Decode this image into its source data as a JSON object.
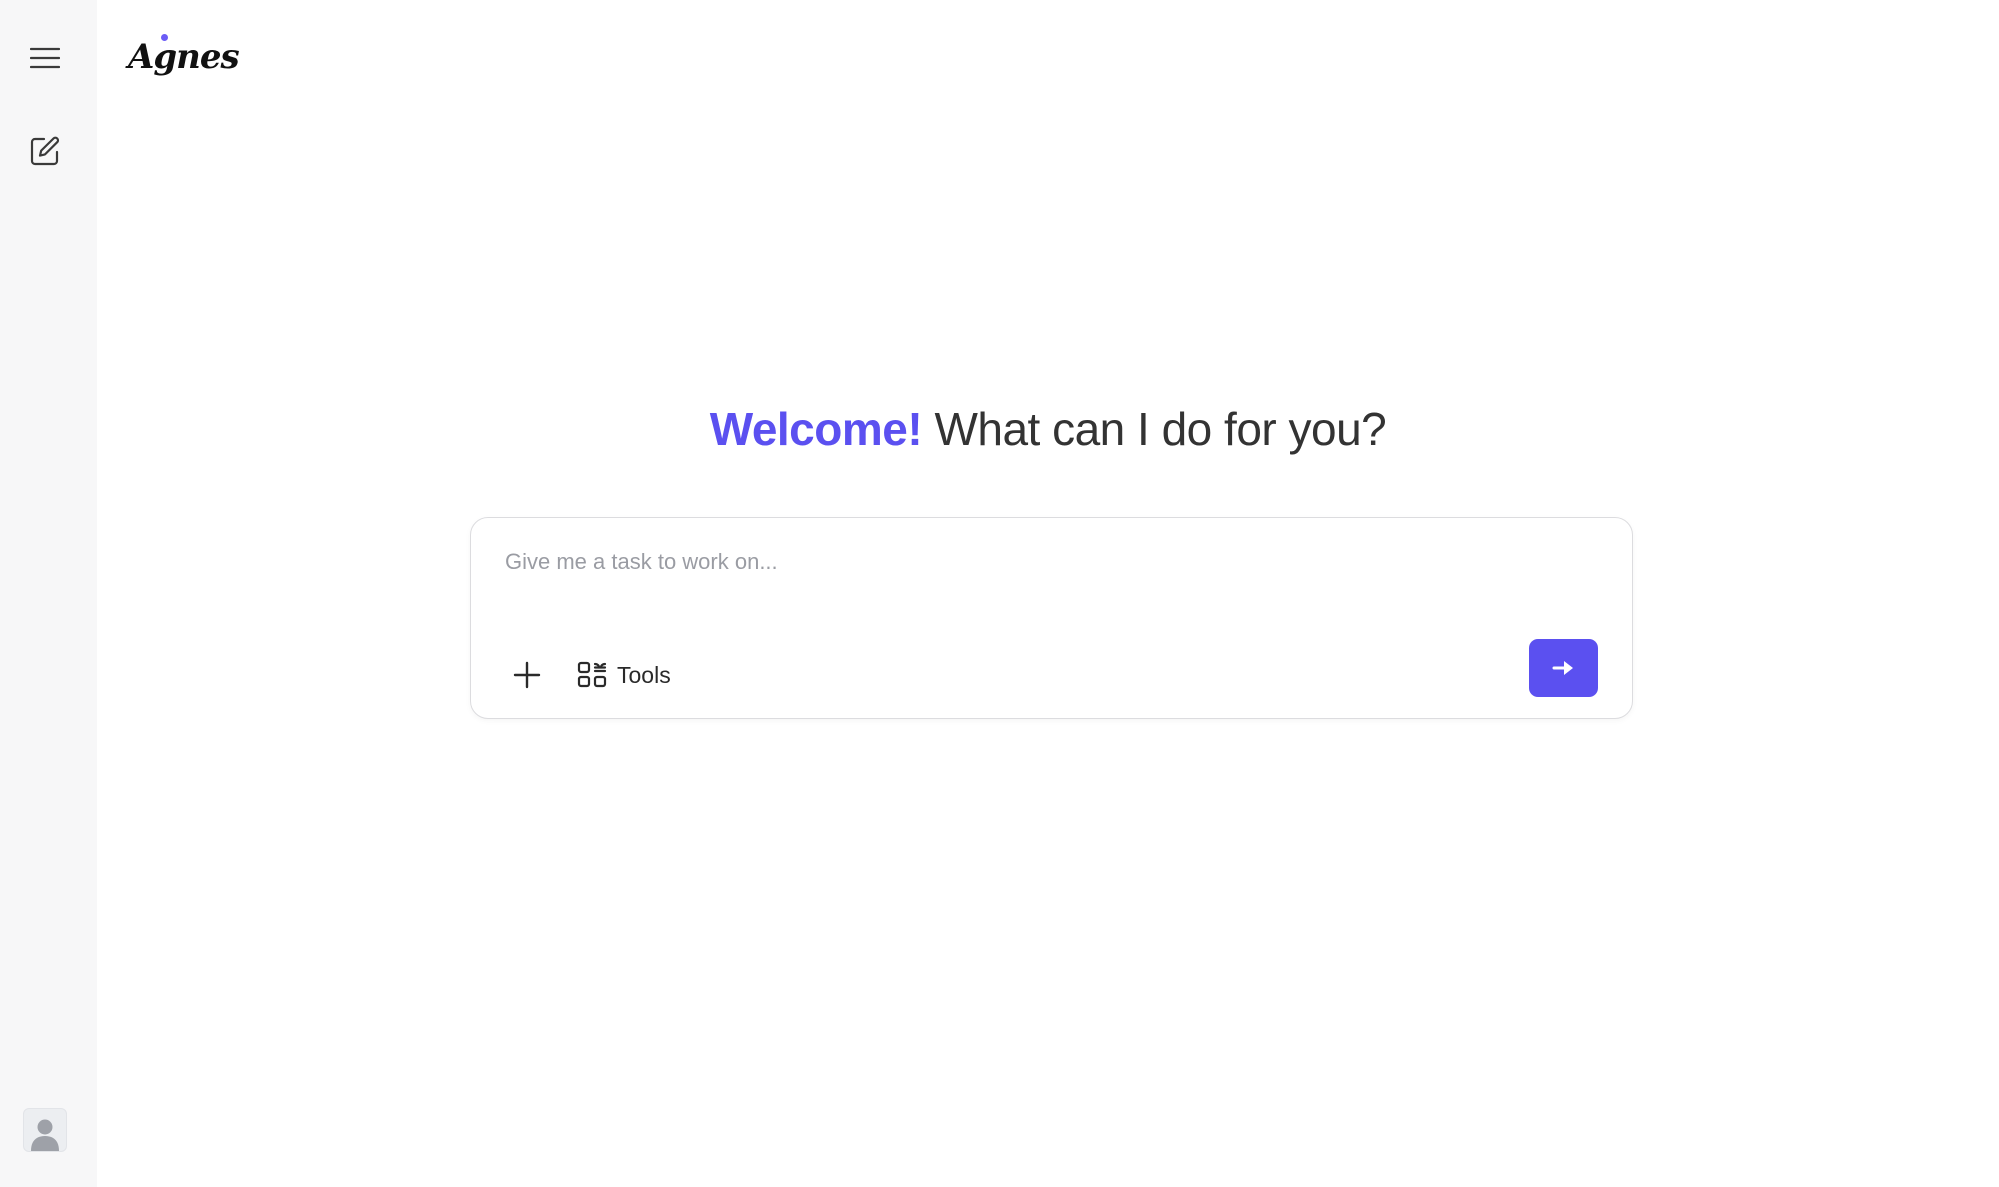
{
  "app": {
    "logo_text": "Agnes"
  },
  "sidebar": {
    "menu_icon": "hamburger-menu-icon",
    "new_chat_icon": "compose-icon",
    "avatar_icon": "user-avatar-icon"
  },
  "headline": {
    "accent": "Welcome!",
    "rest": "What can I do for you?"
  },
  "composer": {
    "placeholder": "Give me a task to work on...",
    "value": "",
    "attach_icon": "plus-icon",
    "tools_icon": "tools-icon",
    "tools_label": "Tools",
    "send_icon": "arrow-right-icon"
  },
  "colors": {
    "accent": "#5b50f0",
    "sidebar_bg": "#f7f7f8",
    "logo_dot": "#6b5cf6"
  }
}
